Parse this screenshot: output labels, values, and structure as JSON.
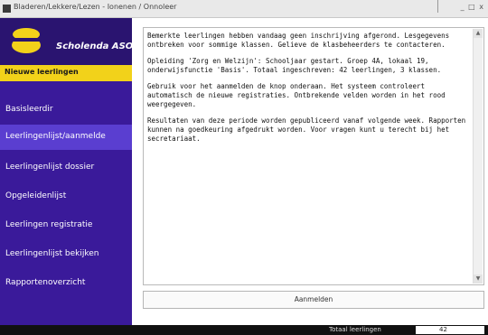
{
  "window": {
    "title": "Bladeren/Lekkere/Lezen - Ionenen / Onnoleer",
    "controls": "_ □ x"
  },
  "sidebar": {
    "logo_text": "Scholenda ASO",
    "new_row_label": "Nieuwe leerlingen",
    "items": [
      {
        "label": "Basisleerdir",
        "active": false
      },
      {
        "label": "Leerlingenlijst/aanmelde",
        "active": true
      },
      {
        "label": "Leerlingenlijst dossier",
        "active": false
      },
      {
        "label": "Opgeleidenlijst",
        "active": false
      },
      {
        "label": "Leerlingen registratie",
        "active": false
      },
      {
        "label": "Leerlingenlijst bekijken",
        "active": false
      },
      {
        "label": "Rapportenoverzicht",
        "active": false
      }
    ]
  },
  "content": {
    "paragraphs": [
      "Bemerkte leerlingen hebben vandaag geen inschrijving afgerond. Lesgegevens ontbreken voor sommige klassen. Gelieve de klasbeheerders te contacteren.",
      "Opleiding 'Zorg en Welzijn': Schooljaar gestart. Groep 4A, lokaal 19, onderwijsfunctie 'Basis'. Totaal ingeschreven: 42 leerlingen, 3 klassen.",
      "Gebruik voor het aanmelden de knop onderaan. Het systeem controleert automatisch de nieuwe registraties. Ontbrekende velden worden in het rood weergegeven.",
      "Resultaten van deze periode worden gepubliceerd vanaf volgende week. Rapporten kunnen na goedkeuring afgedrukt worden. Voor vragen kunt u terecht bij het secretariaat."
    ],
    "action_button_label": "Aanmelden",
    "scroll_up": "▲",
    "scroll_down": "▼"
  },
  "statusbar": {
    "label": "Totaal leerlingen",
    "value": "42"
  },
  "colors": {
    "sidebar_bg": "#3a1a9a",
    "logo_bg": "#2a1470",
    "active_item": "#5a3ed0",
    "new_row_bg": "#f2d21a",
    "logo_mark": "#f2d21a"
  }
}
